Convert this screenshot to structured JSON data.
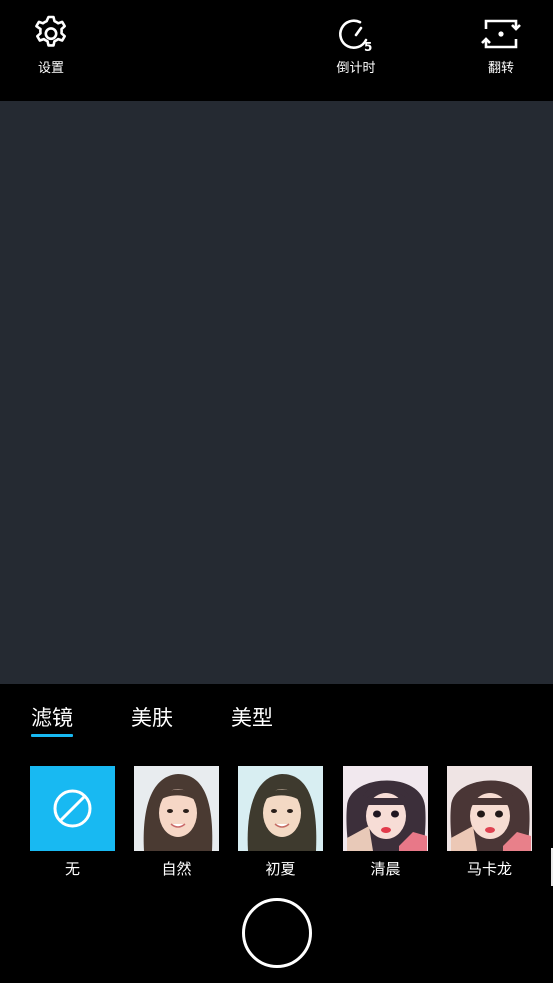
{
  "topbar": {
    "settings_label": "设置",
    "timer_label": "倒计时",
    "timer_value": "5",
    "flip_label": "翻转"
  },
  "tabs": [
    {
      "label": "滤镜",
      "active": true
    },
    {
      "label": "美肤",
      "active": false
    },
    {
      "label": "美型",
      "active": false
    }
  ],
  "filters": [
    {
      "name": "无",
      "selected": true,
      "icon": "no-filter-icon",
      "color": "#18b9f2"
    },
    {
      "name": "自然",
      "selected": false
    },
    {
      "name": "初夏",
      "selected": false
    },
    {
      "name": "清晨",
      "selected": false
    },
    {
      "name": "马卡龙",
      "selected": false
    }
  ],
  "colors": {
    "accent": "#18b9f2",
    "preview_bg": "#252a32",
    "bar_bg": "#000000"
  }
}
